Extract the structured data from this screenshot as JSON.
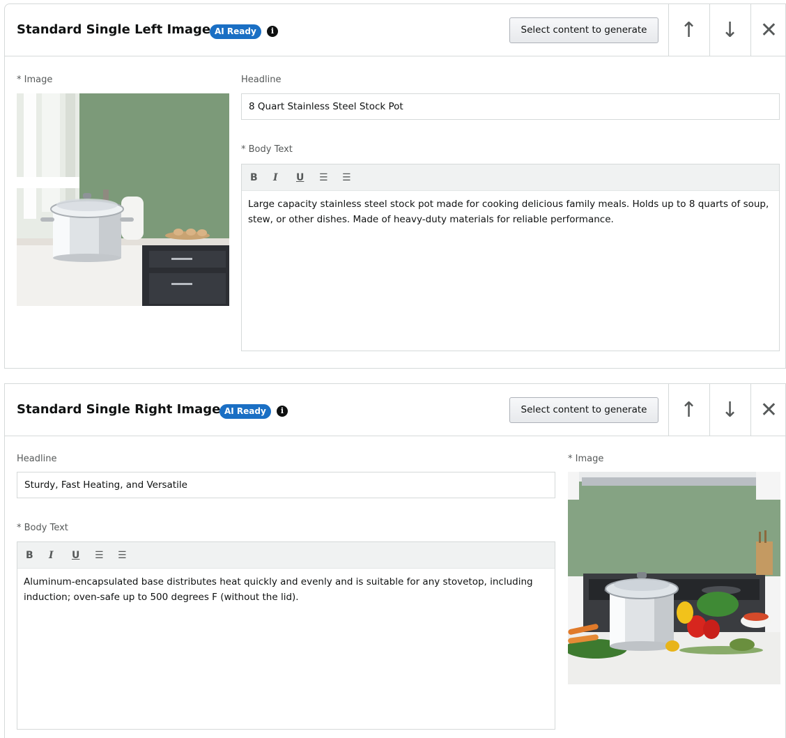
{
  "modules": [
    {
      "title": "Standard Single Left Image",
      "ai_badge": "AI Ready",
      "info_icon": "info-circle-icon",
      "generate_button": "Select content to generate",
      "controls": {
        "up": "↑",
        "down": "↓",
        "close": "✕"
      },
      "image_label": "* Image",
      "headline_label": "Headline",
      "headline_value": "8 Quart Stainless Steel Stock Pot",
      "body_label": "* Body Text",
      "toolbar": {
        "bold": "B",
        "italic": "I",
        "underline": "U",
        "bullets": "☰",
        "numbers": "☰"
      },
      "body_text": "Large capacity stainless steel stock pot made for cooking delicious family meals. Holds up to 8 quarts of soup, stew, or other dishes. Made of heavy-duty materials for reliable performance."
    },
    {
      "title": "Standard Single Right Image",
      "ai_badge": "AI Ready",
      "info_icon": "info-circle-icon",
      "generate_button": "Select content to generate",
      "controls": {
        "up": "↑",
        "down": "↓",
        "close": "✕"
      },
      "image_label": "* Image",
      "headline_label": "Headline",
      "headline_value": "Sturdy, Fast Heating, and Versatile",
      "body_label": "* Body Text",
      "toolbar": {
        "bold": "B",
        "italic": "I",
        "underline": "U",
        "bullets": "☰",
        "numbers": "☰"
      },
      "body_text": "Aluminum-encapsulated base distributes heat quickly and evenly and is suitable for any stovetop, including induction; oven-safe up to 500 degrees F (without the lid)."
    }
  ],
  "colors": {
    "badge": "#1a6fc4",
    "border": "#d5d9d9",
    "wall_green": "#7f9f7e"
  }
}
